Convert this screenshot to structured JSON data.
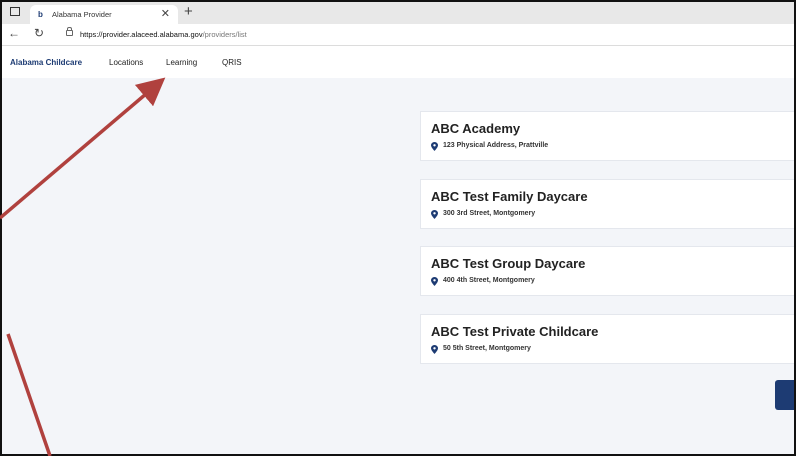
{
  "browser": {
    "tab_title": "Alabama Provider",
    "tab_favicon": "b-logo-icon",
    "close_icon": "close-icon",
    "new_tab_icon": "plus-icon",
    "back_icon": "back-arrow-icon",
    "refresh_icon": "refresh-icon",
    "url_host": "https://provider.alaceed.alabama.gov",
    "url_path": "/providers/list"
  },
  "site_nav": {
    "brand": "Alabama Childcare",
    "links": [
      "Locations",
      "Learning",
      "QRIS"
    ]
  },
  "providers": [
    {
      "name": "ABC Academy",
      "address": "123 Physical Address, Prattville"
    },
    {
      "name": "ABC Test Family Daycare",
      "address": "300 3rd Street, Montgomery"
    },
    {
      "name": "ABC Test Group Daycare",
      "address": "400 4th Street, Montgomery"
    },
    {
      "name": "ABC Test Private Childcare",
      "address": "50 5th Street, Montgomery"
    }
  ],
  "colors": {
    "brand": "#1d3b73",
    "annotation_arrow": "#b0413e",
    "page_background": "#f3f5f9"
  }
}
